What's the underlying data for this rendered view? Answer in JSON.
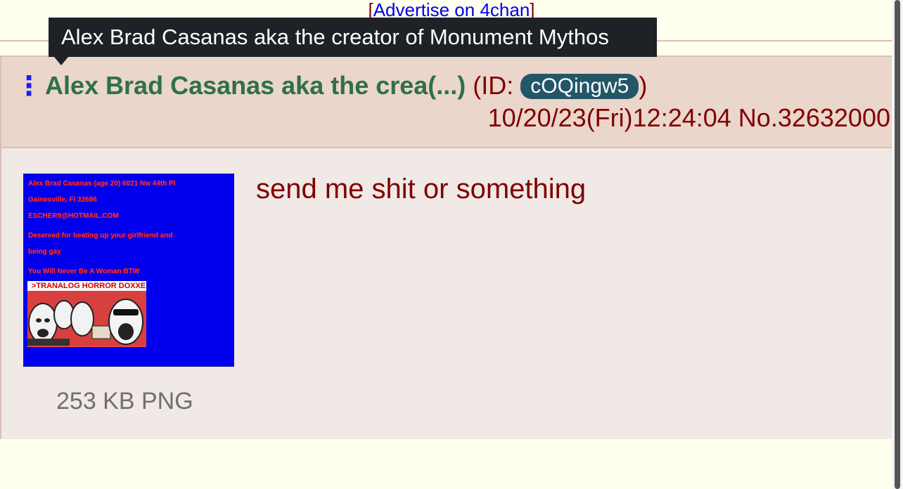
{
  "ad": {
    "left_bracket": "[",
    "link_text": "Advertise on 4chan",
    "right_bracket": "]"
  },
  "tooltip": {
    "text": "Alex Brad Casanas aka the creator of Monument Mythos"
  },
  "post": {
    "menu_icon_glyph": "⋮",
    "name": "Alex Brad Casanas aka the crea(...)",
    "id_prefix": " (ID: ",
    "id_value": "cOQingw5",
    "id_suffix": ")",
    "datetime": "10/20/23(Fri)12:24:04",
    "number_text": "No.32632000",
    "message": "send me shit or something",
    "file_info": "253 KB PNG",
    "thumbnail_lines": [
      "Alex Brad Casanas (age 20) 6021 Nw 44th Pl",
      "Gainesville, Fl 32686",
      "ESCHER9@HOTMAIL.COM",
      "Deserved for beating up your girlfriend and",
      "being gay",
      "You Will Never Be A Woman BTW"
    ],
    "thumbnail_meme_title": ">TRANALOG HORROR DOXXED!"
  },
  "colors": {
    "page_background": "#ffffee",
    "post_background": "#f0e0d6",
    "name_color": "#2f7048",
    "text_color": "#800000",
    "link_color": "#0000ee",
    "id_badge_background": "#235667",
    "tooltip_background": "#1e2226"
  },
  "icons": {
    "menu": "vertical-ellipsis-icon"
  }
}
